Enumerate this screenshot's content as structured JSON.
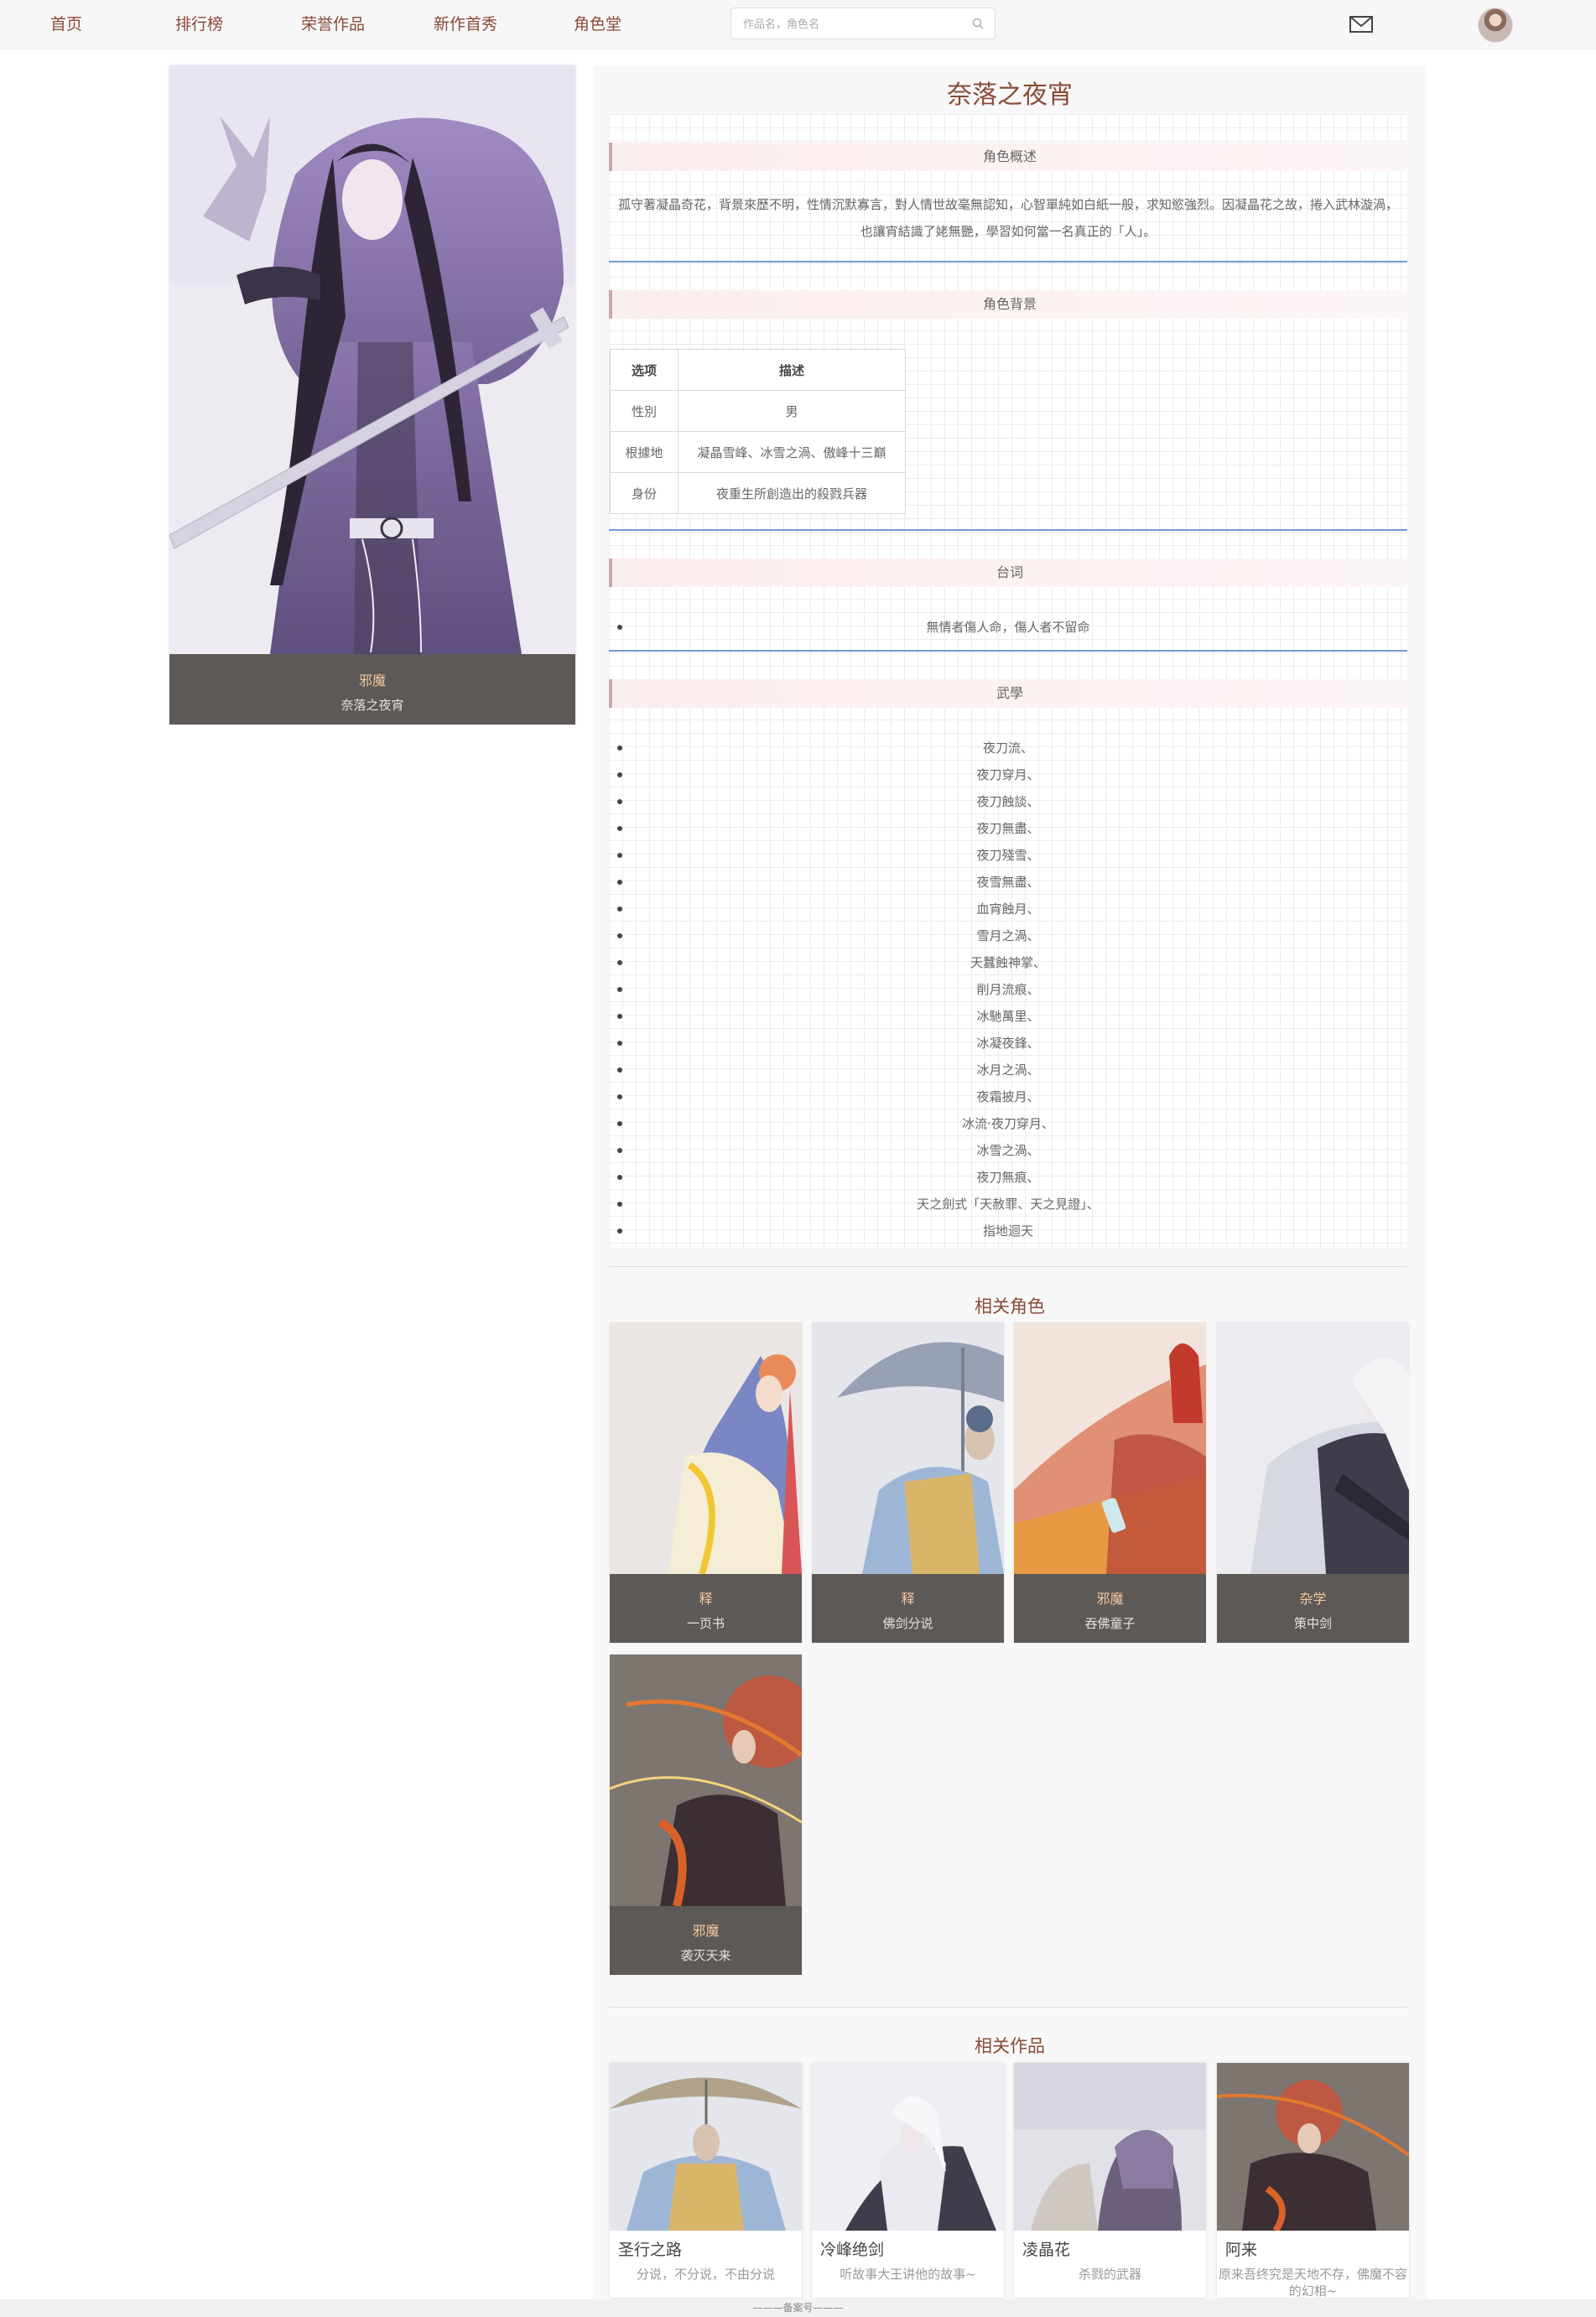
{
  "nav": {
    "items": [
      {
        "label": "首页"
      },
      {
        "label": "排行榜"
      },
      {
        "label": "荣誉作品"
      },
      {
        "label": "新作首秀"
      },
      {
        "label": "角色堂"
      }
    ],
    "search_placeholder": "作品名，角色名",
    "icons": [
      "search-icon",
      "mail-icon",
      "avatar"
    ]
  },
  "character": {
    "type": "邪魔",
    "name": "奈落之夜宵"
  },
  "detail": {
    "title": "奈落之夜宵",
    "summary_title": "角色概述",
    "summary_text": "孤守著凝晶奇花，背景來歷不明，性情沉默寡言，對人情世故毫無認知，心智單純如白紙一般，求知慾強烈。因凝晶花之故，捲入武林漩渦，也讓宵結識了姥無艷，學習如何當一名真正的「人」。",
    "background_title": "角色背景",
    "table": {
      "headers": [
        "选项",
        "描述"
      ],
      "rows": [
        [
          "性別",
          "男"
        ],
        [
          "根據地",
          "凝晶雪峰、冰雪之渦、傲峰十三巔"
        ],
        [
          "身份",
          "夜重生所創造出的殺戮兵器"
        ]
      ]
    },
    "lines_title": "台词",
    "lines": [
      "無情者傷人命，傷人者不留命"
    ],
    "martial_title": "武學",
    "martial": [
      "夜刀流、",
      "夜刀穿月、",
      "夜刀蝕談、",
      "夜刀無盡、",
      "夜刀殘雪、",
      "夜雪無盡、",
      "血宵蝕月、",
      "雪月之渦、",
      "天蠶蝕神掌、",
      "削月流痕、",
      "冰馳萬里、",
      "冰凝夜鋒、",
      "冰月之渦、",
      "夜霜披月、",
      "冰流·夜刀穿月、",
      "冰雪之渦、",
      "夜刀無痕、",
      "天之劍式「天赦罪、天之見證」、",
      "指地迴天"
    ]
  },
  "related_roles": {
    "title": "相关角色",
    "items": [
      {
        "type": "释",
        "name": "一页书"
      },
      {
        "type": "释",
        "name": "佛剑分说"
      },
      {
        "type": "邪魔",
        "name": "吞佛童子"
      },
      {
        "type": "杂学",
        "name": "策中剑"
      },
      {
        "type": "邪魔",
        "name": "袭灭天来"
      }
    ]
  },
  "related_works": {
    "title": "相关作品",
    "items": [
      {
        "title": "圣行之路",
        "desc": "分说，不分说，不由分说"
      },
      {
        "title": "冷峰绝剑",
        "desc": "听故事大王讲他的故事~"
      },
      {
        "title": "凌晶花",
        "desc": "杀戮的武器"
      },
      {
        "title": "阿来",
        "desc": "原来吾终究是天地不存，佛魔不容的幻相~"
      }
    ]
  },
  "footer": {
    "text": "———备案号———"
  },
  "colors": {
    "accent": "#8a4a36",
    "caption_bg": "#5d5957",
    "caption_type": "#f4c9a0",
    "divider_blue": "#6f9bd6"
  }
}
